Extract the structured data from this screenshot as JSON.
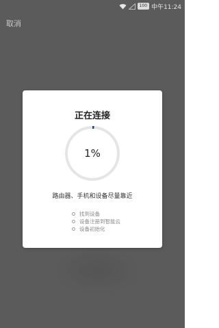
{
  "status_bar": {
    "time": "中午11:24",
    "battery": "100",
    "wifi_icon": "wifi-icon",
    "signal_icon": "signal-icon"
  },
  "header": {
    "cancel_label": "取消"
  },
  "dialog": {
    "title": "正在连接",
    "progress_percent": 1,
    "progress_label": "1%",
    "hint": "路由器、手机和设备尽量靠近",
    "steps": [
      {
        "label": "找到设备"
      },
      {
        "label": "设备注册到智能云"
      },
      {
        "label": "设备初始化"
      }
    ]
  },
  "colors": {
    "overlay": "#5b5b5b",
    "dialog_bg": "#ffffff",
    "ring_track": "#e5e5e5",
    "progress_accent": "#1f3f8f"
  }
}
